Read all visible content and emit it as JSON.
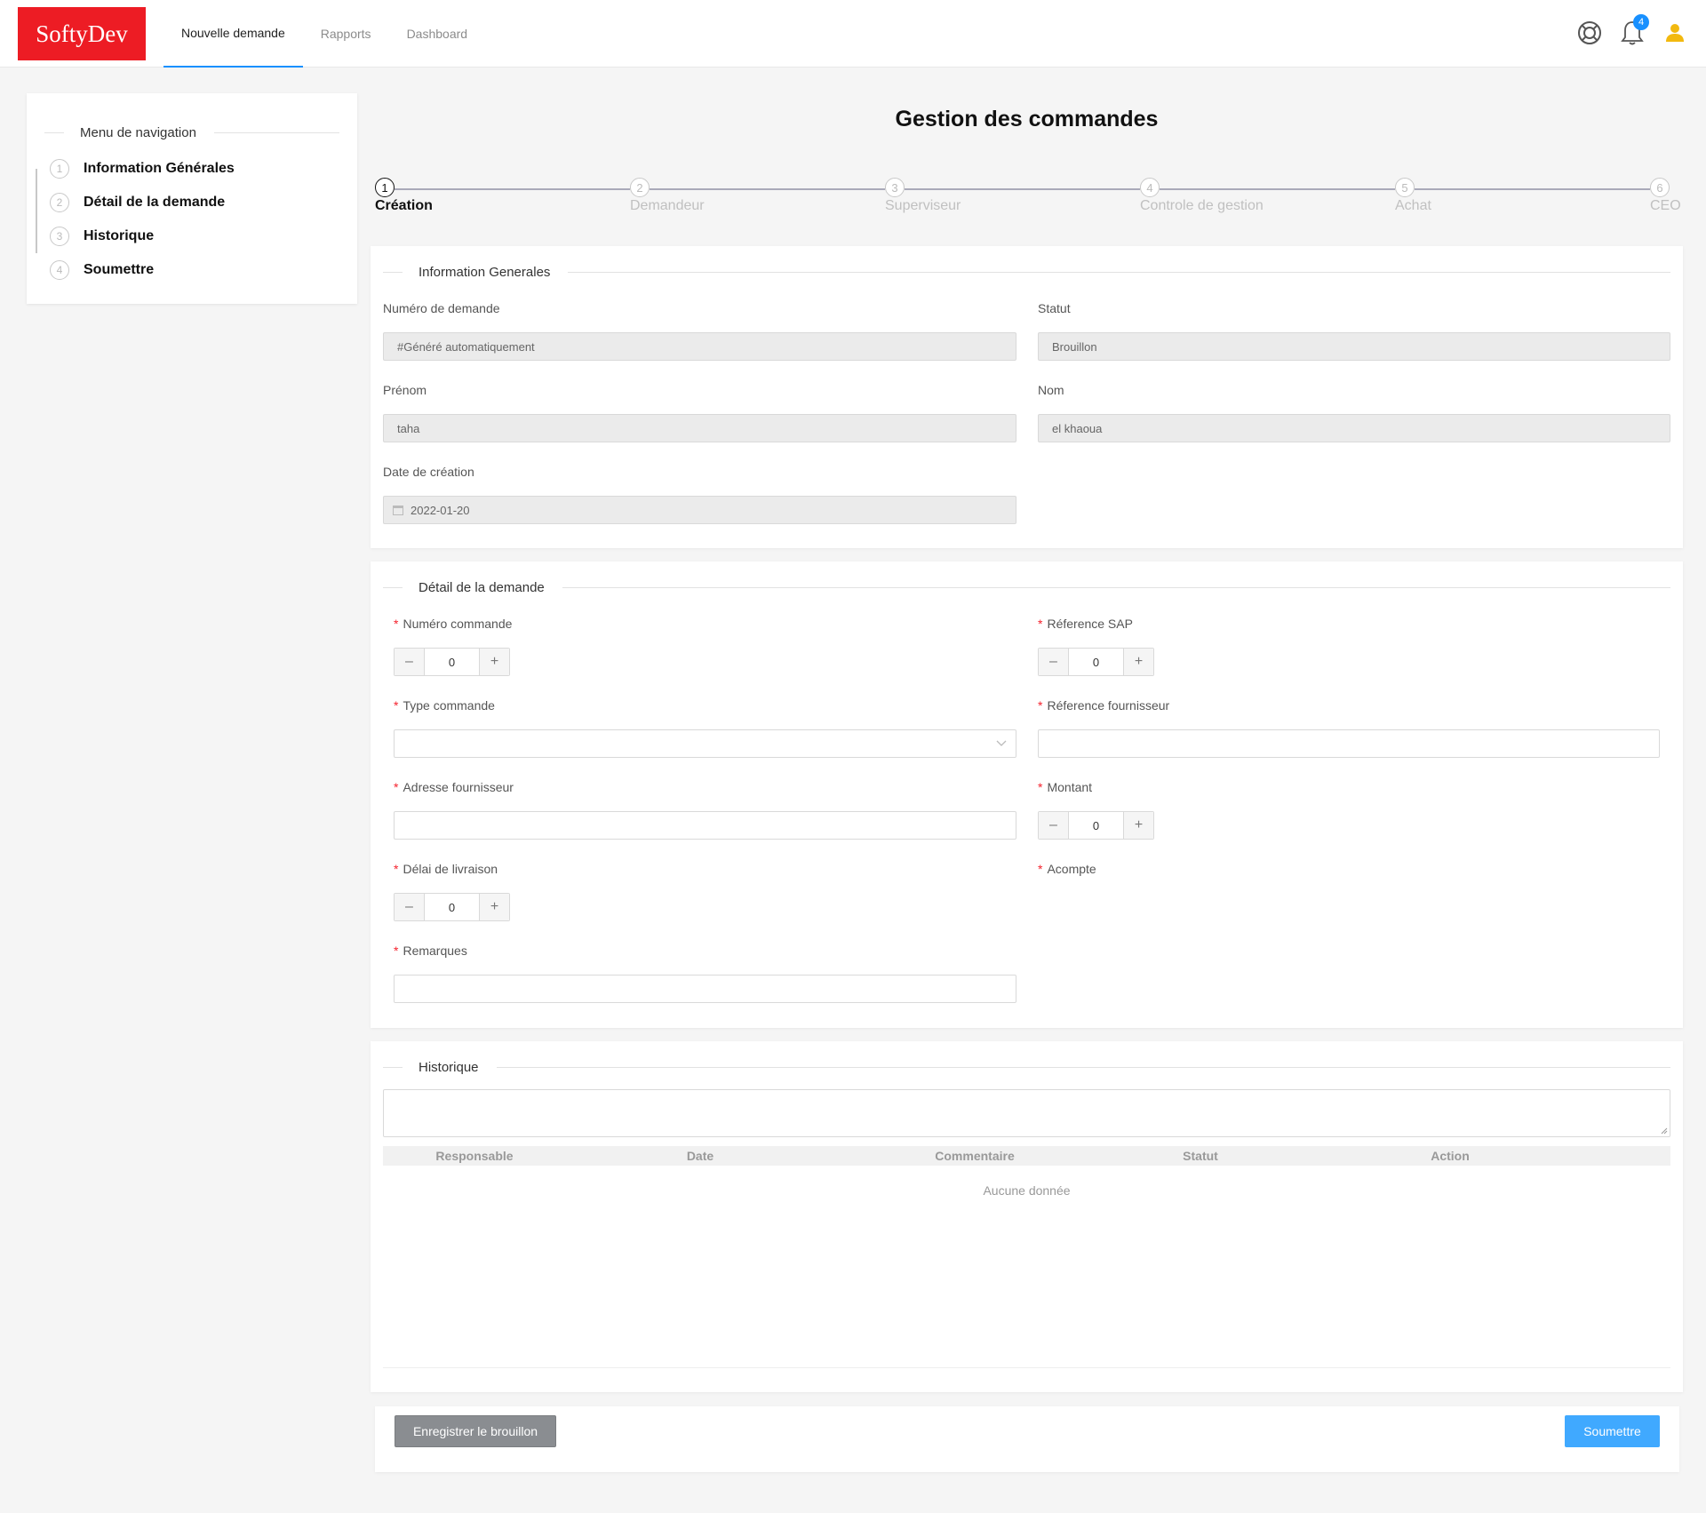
{
  "header": {
    "logo": "SoftyDev",
    "nav": [
      "Nouvelle demande",
      "Rapports",
      "Dashboard"
    ],
    "notification_count": "4",
    "accent_color": "#1890ff",
    "logo_color": "#ed1c24"
  },
  "sidebar": {
    "title": "Menu de navigation",
    "items": [
      {
        "num": "1",
        "label": "Information Générales"
      },
      {
        "num": "2",
        "label": "Détail de la demande"
      },
      {
        "num": "3",
        "label": "Historique"
      },
      {
        "num": "4",
        "label": "Soumettre"
      }
    ]
  },
  "page": {
    "title": "Gestion des commandes"
  },
  "steps": [
    {
      "num": "1",
      "label": "Création"
    },
    {
      "num": "2",
      "label": "Demandeur"
    },
    {
      "num": "3",
      "label": "Superviseur"
    },
    {
      "num": "4",
      "label": "Controle de gestion"
    },
    {
      "num": "5",
      "label": "Achat"
    },
    {
      "num": "6",
      "label": "CEO"
    }
  ],
  "info": {
    "title": "Information Generales",
    "numero_label": "Numéro de demande",
    "numero_value": "#Généré automatiquement",
    "statut_label": "Statut",
    "statut_value": "Brouillon",
    "prenom_label": "Prénom",
    "prenom_value": "taha",
    "nom_label": "Nom",
    "nom_value": "el khaoua",
    "date_label": "Date de création",
    "date_value": "2022-01-20"
  },
  "detail": {
    "title": "Détail de la demande",
    "numero_commande_label": "Numéro commande",
    "numero_commande_value": "0",
    "reference_sap_label": "Réference SAP",
    "reference_sap_value": "0",
    "type_commande_label": "Type commande",
    "reference_fournisseur_label": "Réference fournisseur",
    "adresse_fournisseur_label": "Adresse fournisseur",
    "montant_label": "Montant",
    "montant_value": "0",
    "delai_label": "Délai de livraison",
    "delai_value": "0",
    "acompte_label": "Acompte",
    "remarques_label": "Remarques"
  },
  "historique": {
    "title": "Historique",
    "columns": [
      "Responsable",
      "Date",
      "Commentaire",
      "Statut",
      "Action"
    ],
    "empty": "Aucune donnée"
  },
  "footer": {
    "draft_button": "Enregistrer le brouillon",
    "submit_button": "Soumettre"
  }
}
